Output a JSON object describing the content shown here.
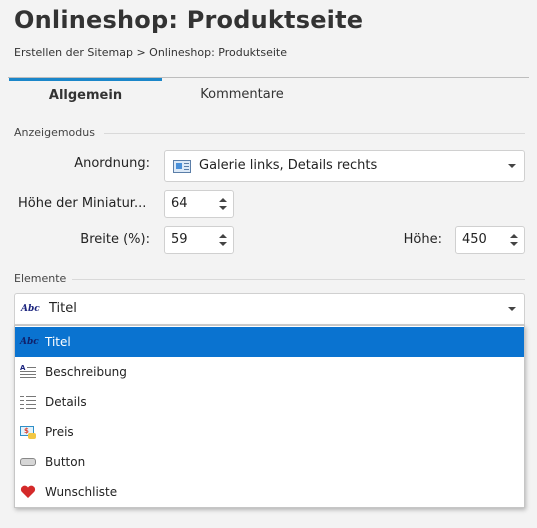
{
  "header": {
    "title": "Onlineshop: Produktseite",
    "breadcrumb": "Erstellen der Sitemap > Onlineshop: Produktseite"
  },
  "tabs": [
    {
      "label": "Allgemein",
      "active": true
    },
    {
      "label": "Kommentare",
      "active": false
    }
  ],
  "anzeigemodus": {
    "section_label": "Anzeigemodus",
    "anordnung_label": "Anordnung:",
    "anordnung_value": "Galerie links, Details rechts",
    "miniatur_label": "Höhe der Miniatur...",
    "miniatur_value": "64",
    "breite_label": "Breite (%):",
    "breite_value": "59",
    "hoehe_label": "Höhe:",
    "hoehe_value": "450"
  },
  "elemente": {
    "section_label": "Elemente",
    "selected_value": "Titel",
    "abc_glyph": "Abc",
    "options": [
      {
        "label": "Titel",
        "icon": "abc-icon",
        "selected": true
      },
      {
        "label": "Beschreibung",
        "icon": "text-lines-icon",
        "selected": false
      },
      {
        "label": "Details",
        "icon": "details-list-icon",
        "selected": false
      },
      {
        "label": "Preis",
        "icon": "price-icon",
        "selected": false
      },
      {
        "label": "Button",
        "icon": "button-icon",
        "selected": false
      },
      {
        "label": "Wunschliste",
        "icon": "heart-icon",
        "selected": false
      }
    ]
  },
  "colors": {
    "accent": "#1a86c9",
    "selection": "#0a73d0",
    "heart": "#d42a2a"
  }
}
